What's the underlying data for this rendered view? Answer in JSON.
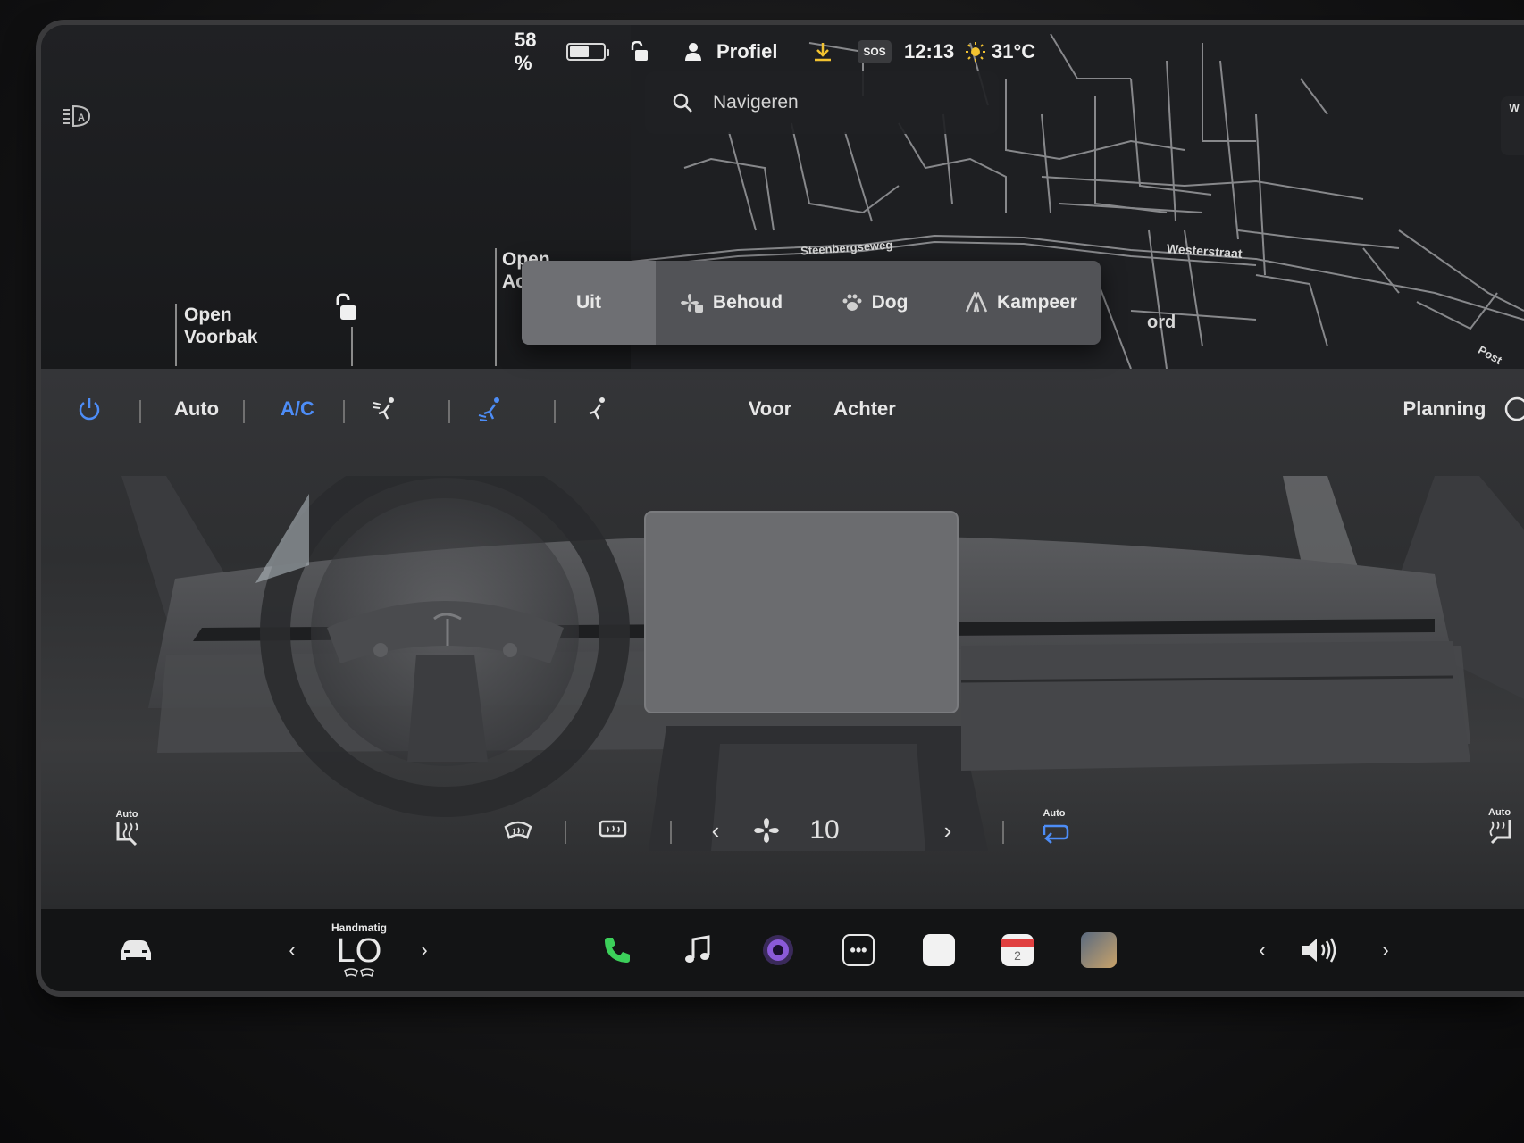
{
  "status": {
    "battery_percent_text": "58 %",
    "battery_level": 0.58,
    "profile_label": "Profiel",
    "sos_label": "SOS",
    "time": "12:13",
    "temperature": "31°C"
  },
  "car_panel": {
    "frunk_label_line1": "Open",
    "frunk_label_line2": "Voorbak",
    "trunk_label_line1": "Open",
    "trunk_label_line2": "Ac"
  },
  "map": {
    "search_placeholder": "Navigeren",
    "streets": [
      "Steenbergseweg",
      "Westerstraat",
      "ord",
      "Post"
    ],
    "edge_letter": "W"
  },
  "climate_mode": {
    "options": [
      {
        "label": "Uit",
        "icon": ""
      },
      {
        "label": "Behoud",
        "icon": "fan-keep-icon"
      },
      {
        "label": "Dog",
        "icon": "paw-icon"
      },
      {
        "label": "Kampeer",
        "icon": "tent-icon"
      }
    ],
    "selected": "Uit"
  },
  "climate": {
    "auto_label": "Auto",
    "ac_label": "A/C",
    "front_label": "Voor",
    "rear_label": "Achter",
    "schedule_label": "Planning",
    "fan_speed": "10",
    "seat_auto_left": "Auto",
    "recirc_auto": "Auto",
    "seat_auto_right": "Auto"
  },
  "dock": {
    "temp_mode": "Handmatig",
    "temperature": "LO",
    "calendar_day": "2"
  },
  "colors": {
    "accent_blue": "#4d8df7",
    "download_yellow": "#f2c230",
    "phone_green": "#3ccf5a",
    "sun_yellow": "#f2c230"
  }
}
